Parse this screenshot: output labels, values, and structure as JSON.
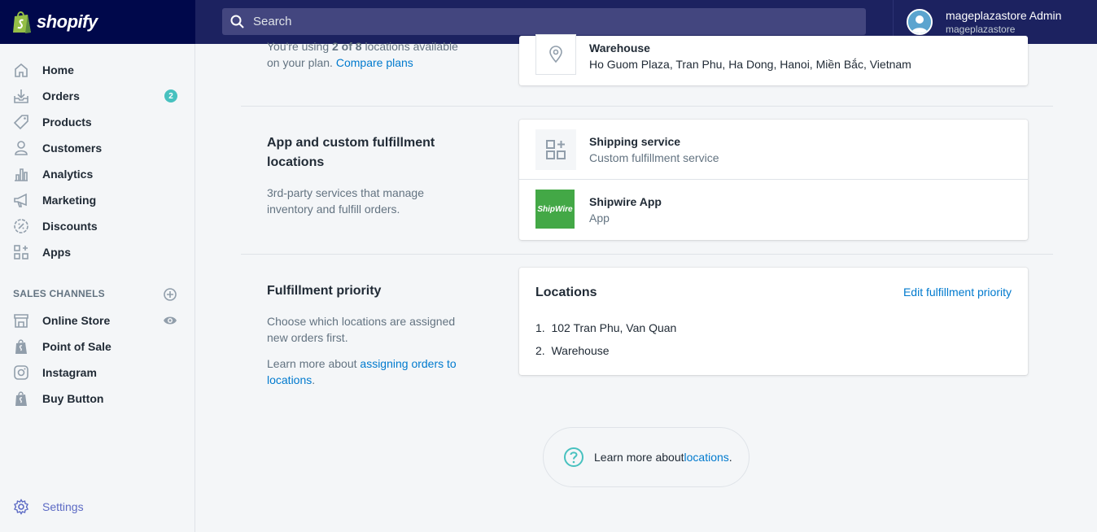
{
  "brand": {
    "name": "shopify"
  },
  "search": {
    "placeholder": "Search"
  },
  "user": {
    "name": "mageplazastore Admin",
    "store": "mageplazastore"
  },
  "sidebar": {
    "items": [
      {
        "label": "Home",
        "icon": "home-icon"
      },
      {
        "label": "Orders",
        "icon": "orders-icon",
        "badge": "2"
      },
      {
        "label": "Products",
        "icon": "tag-icon"
      },
      {
        "label": "Customers",
        "icon": "person-icon"
      },
      {
        "label": "Analytics",
        "icon": "bar-chart-icon"
      },
      {
        "label": "Marketing",
        "icon": "megaphone-icon"
      },
      {
        "label": "Discounts",
        "icon": "discount-icon"
      },
      {
        "label": "Apps",
        "icon": "apps-icon"
      }
    ],
    "channels_title": "SALES CHANNELS",
    "channels": [
      {
        "label": "Online Store",
        "icon": "store-icon"
      },
      {
        "label": "Point of Sale",
        "icon": "shopify-bag-icon"
      },
      {
        "label": "Instagram",
        "icon": "instagram-icon"
      },
      {
        "label": "Buy Button",
        "icon": "shopify-bag-icon"
      }
    ],
    "settings_label": "Settings"
  },
  "main": {
    "locations_plan": {
      "line1_pre": "You're using ",
      "line1_bold": "2 of 8",
      "line1_post": " locations available",
      "line2_pre": "on your plan. ",
      "compare_link": "Compare plans"
    },
    "warehouse": {
      "title": "Warehouse",
      "address": "Ho Guom Plaza, Tran Phu, Ha Dong, Hanoi, Miền Bắc, Vietnam"
    },
    "app_section": {
      "title_line1": "App and custom fulfillment",
      "title_line2": "locations",
      "desc_line1": "3rd-party services that manage",
      "desc_line2": "inventory and fulfill orders.",
      "rows": [
        {
          "title": "Shipping service",
          "sub": "Custom fulfillment service"
        },
        {
          "title": "Shipwire App",
          "sub": "App",
          "logo_text": "ShipWire"
        }
      ]
    },
    "priority_section": {
      "title": "Fulfillment priority",
      "desc_line1": "Choose which locations are assigned",
      "desc_line2": "new orders first.",
      "learn_pre": "Learn more about ",
      "learn_link_line1": "assigning orders to",
      "learn_link_line2": "locations",
      "learn_post": ".",
      "card_title": "Locations",
      "edit_link": "Edit fulfillment priority",
      "locations": [
        {
          "num": "1.",
          "name": "102 Tran Phu, Van Quan"
        },
        {
          "num": "2.",
          "name": "Warehouse"
        }
      ]
    },
    "help": {
      "pre": "Learn more about ",
      "link": "locations",
      "post": "."
    }
  },
  "colors": {
    "topbar": "#1c2260",
    "logo_bg": "#00084b",
    "accent": "#47c1bf",
    "link": "#007ace",
    "settings": "#5c6ac4",
    "shipwire_green": "#43a846"
  }
}
